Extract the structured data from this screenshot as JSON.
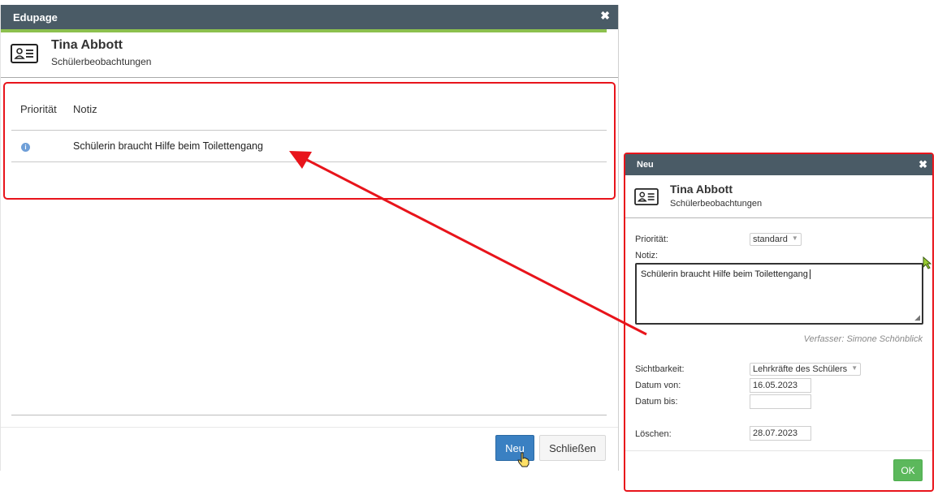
{
  "main_dialog": {
    "title": "Edupage",
    "close_glyph": "✖",
    "student_name": "Tina Abbott",
    "subtitle": "Schülerbeobachtungen",
    "table": {
      "headers": [
        "Priorität",
        "Notiz"
      ],
      "rows": [
        {
          "priority_icon": "info-icon",
          "note": "Schülerin braucht Hilfe beim Toilettengang"
        }
      ]
    },
    "buttons": {
      "new": "Neu",
      "close": "Schließen"
    }
  },
  "neu_dialog": {
    "title": "Neu",
    "close_glyph": "✖",
    "student_name": "Tina Abbott",
    "subtitle": "Schülerbeobachtungen",
    "fields": {
      "priority_label": "Priorität:",
      "priority_value": "standard",
      "note_label": "Notiz:",
      "note_value": "Schülerin braucht Hilfe beim Toilettengang",
      "author": "Verfasser: Simone Schönblick",
      "visibility_label": "Sichtbarkeit:",
      "visibility_value": "Lehrkräfte des Schülers",
      "date_from_label": "Datum von:",
      "date_from_value": "16.05.2023",
      "date_to_label": "Datum bis:",
      "date_to_value": "",
      "delete_label": "Löschen:",
      "delete_value": "28.07.2023"
    },
    "buttons": {
      "ok": "OK"
    }
  },
  "colors": {
    "titlebar": "#4a5b66",
    "accent_green": "#8cc04e",
    "primary_blue": "#3a80c2",
    "ok_green": "#5cb85c",
    "highlight_red": "#e8141b"
  }
}
